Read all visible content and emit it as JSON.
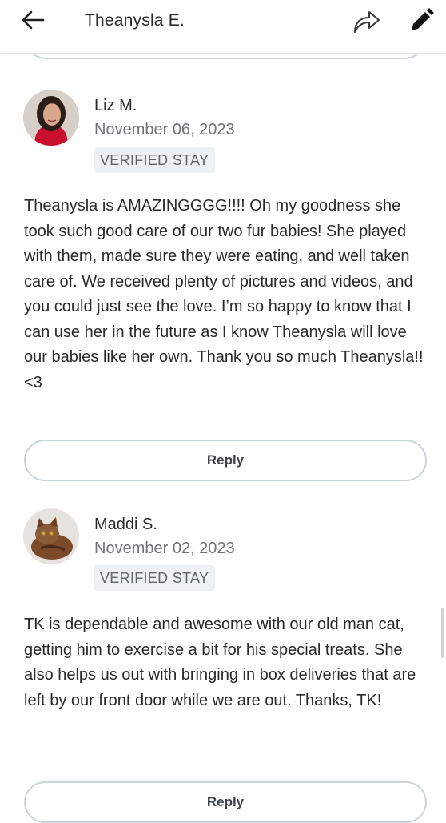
{
  "header": {
    "title": "Theanysla E."
  },
  "reviews": [
    {
      "name": "Liz M.",
      "date": "November 06, 2023",
      "badge": "VERIFIED STAY",
      "text": "Theanysla is AMAZINGGGG!!!! Oh my goodness she took such good care of our two fur babies! She played with them, made sure they were eating, and well taken care of. We received plenty of pictures and videos, and you could just see the love. I’m so happy to know that I can use her in the future as I know Theanysla will love our babies like her own. Thank you so much Theanysla!! <3",
      "reply_label": "Reply"
    },
    {
      "name": "Maddi S.",
      "date": "November 02, 2023",
      "badge": "VERIFIED STAY",
      "text": "TK is dependable and awesome with our old man cat, getting him to exercise a bit for his special treats. She also helps us out with bringing in box deliveries that are left by our front door while we are out. Thanks, TK!",
      "reply_label": "Reply"
    }
  ],
  "icons": {
    "back": "arrow-left-icon",
    "share": "share-arrow-icon",
    "edit": "pencil-icon"
  },
  "colors": {
    "text": "#2a2a2a",
    "muted": "#6e7479",
    "badge_bg": "#eef1f4",
    "pill_border": "#ccd4db"
  }
}
